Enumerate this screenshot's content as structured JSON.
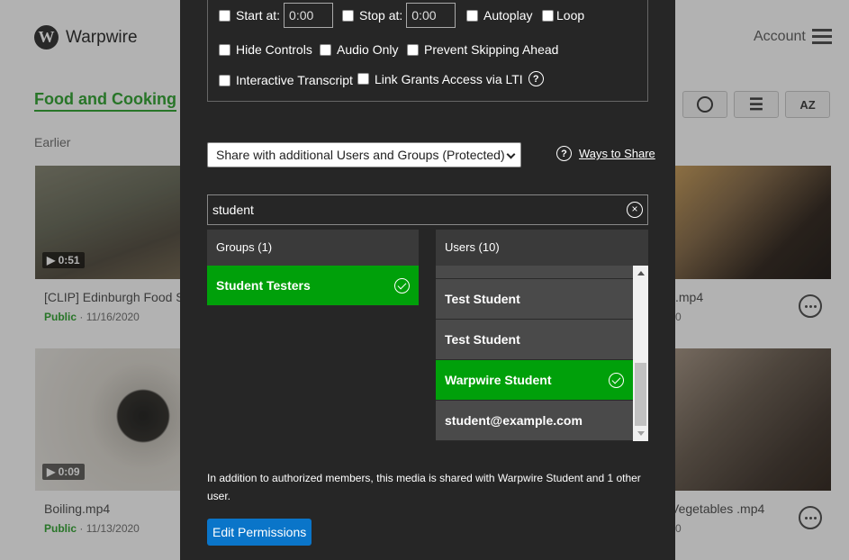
{
  "app": {
    "logo_letter": "W",
    "logo_text": "Warpwire",
    "account_label": "Account"
  },
  "page": {
    "collection_title": "Food and Cooking",
    "section_label": "Earlier",
    "cards": [
      {
        "title": "[CLIP] Edinburgh Food S",
        "visibility": "Public",
        "date": "· 11/16/2020",
        "duration": "▶ 0:51"
      },
      {
        "title": "Boiling.mp4",
        "visibility": "Public",
        "date": "· 11/13/2020",
        "duration": "▶ 0:09"
      },
      {
        "title": ".mp4",
        "visibility": "",
        "date": "0"
      },
      {
        "title": "Vegetables .mp4",
        "visibility": "",
        "date": "0"
      }
    ]
  },
  "modal": {
    "start_at_label": "Start at:",
    "start_at_value": "0:00",
    "stop_at_label": "Stop at:",
    "stop_at_value": "0:00",
    "autoplay_label": "Autoplay",
    "loop_label": "Loop",
    "hide_controls_label": "Hide Controls",
    "audio_only_label": "Audio Only",
    "prevent_skip_label": "Prevent Skipping Ahead",
    "interactive_transcript_label": "Interactive Transcript",
    "link_grants_label": "Link Grants Access via LTI",
    "share_select_value": "Share with additional Users and Groups (Protected)",
    "ways_to_share_label": "Ways to Share",
    "search_value": "student",
    "groups_header": "Groups (1)",
    "groups": [
      {
        "name": "Student Testers",
        "selected": true
      }
    ],
    "users_header": "Users (10)",
    "users": [
      {
        "name": "Test Student",
        "selected": false
      },
      {
        "name": "Test Student",
        "selected": false
      },
      {
        "name": "Warpwire Student",
        "selected": true
      },
      {
        "name": "student@example.com",
        "selected": false
      }
    ],
    "note_text": "In addition to authorized members, this media is shared with Warpwire Student and 1 other user.",
    "edit_button_label": "Edit Permissions"
  },
  "colors": {
    "selected": "#00a00a",
    "accent_green": "#3aa83a",
    "primary_button": "#0a75c9",
    "modal_bg": "#262626"
  },
  "icons": [
    "warpwire-logo-icon",
    "hamburger-menu-icon",
    "circle-view-icon",
    "list-view-icon",
    "sort-az-icon",
    "help-icon",
    "clear-search-icon",
    "check-circle-icon",
    "more-options-icon"
  ]
}
